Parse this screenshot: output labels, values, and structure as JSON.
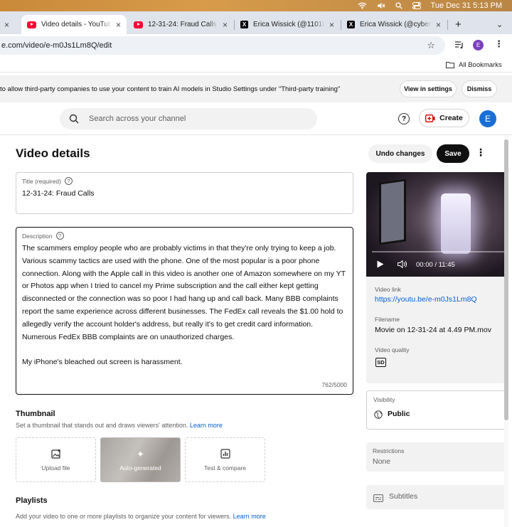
{
  "menubar": {
    "datetime": "Tue Dec 31  5:13 PM"
  },
  "tabs": [
    {
      "label": "Video details - YouTube Studio",
      "active": true,
      "icon": "youtube-icon"
    },
    {
      "label": "12-31-24: Fraud Calls - YouTube",
      "active": false,
      "icon": "youtube-icon"
    },
    {
      "label": "Erica Wissick (@11010010...",
      "active": false,
      "icon": "x-icon"
    },
    {
      "label": "Erica Wissick (@cyberspa...",
      "active": false,
      "icon": "x-icon"
    }
  ],
  "address": {
    "url": "e.com/video/e-m0Js1Lm8Q/edit"
  },
  "bookmarks": {
    "all_label": "All Bookmarks"
  },
  "banner": {
    "text": "to allow third-party companies to use your content to train AI models in Studio Settings under \"Third-party training\"",
    "view_settings": "View in settings",
    "dismiss": "Dismiss"
  },
  "header": {
    "search_placeholder": "Search across your channel",
    "create_label": "Create",
    "avatar_letter": "E"
  },
  "page": {
    "title": "Video details",
    "undo_label": "Undo changes",
    "save_label": "Save"
  },
  "title_field": {
    "label": "Title (required)",
    "value": "12-31-24: Fraud Calls"
  },
  "description_field": {
    "label": "Description",
    "value": "The scammers employ people who are probably victims in that they're only trying to keep a job. Various scammy tactics are used with the phone. One of the most popular is a poor phone connection. Along with the Apple call in this video is another one of Amazon somewhere on my YT or Photos app when I tried to cancel my Prime subscription and the call either kept getting disconnected or the connection was so poor I had hang up and call back. Many BBB complaints report the same experience across different businesses. The FedEx call reveals the $1.00 hold to allegedly verify the account holder's address, but really it's to get credit card information. Numerous FedEx BBB complaints are on unauthorized charges.\n\nMy iPhone's bleached out screen is harassment.",
    "count": "762/5000"
  },
  "thumbnail": {
    "heading": "Thumbnail",
    "subtitle": "Set a thumbnail that stands out and draws viewers' attention.",
    "learn_more": "Learn more",
    "options": [
      "Upload file",
      "Auto-generated",
      "Test & compare"
    ]
  },
  "playlists": {
    "heading": "Playlists",
    "subtitle": "Add your video to one or more playlists to organize your content for viewers.",
    "learn_more": "Learn more"
  },
  "video": {
    "time": "00:00 / 11:45",
    "link_label": "Video link",
    "link": "https://youtu.be/e-m0Js1Lm8Q",
    "filename_label": "Filename",
    "filename": "Movie on 12-31-24 at 4.49 PM.mov",
    "quality_label": "Video quality",
    "quality_badge": "SD"
  },
  "visibility": {
    "label": "Visibility",
    "value": "Public"
  },
  "restrictions": {
    "label": "Restrictions",
    "value": "None"
  },
  "subtitles": {
    "label": "Subtitles"
  }
}
